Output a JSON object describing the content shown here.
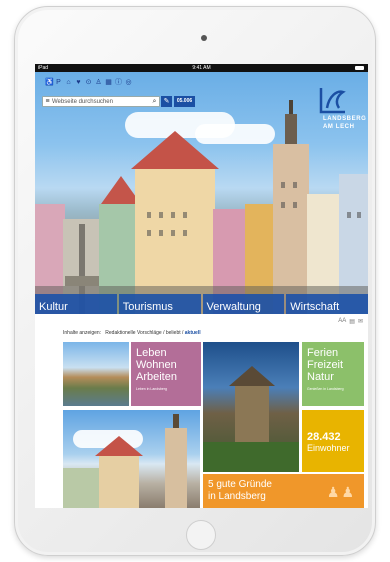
{
  "status_bar": {
    "carrier": "iPad",
    "time": "9:41 AM"
  },
  "header": {
    "search_placeholder": "Webseite durchsuchen",
    "dialog_button": "05.006"
  },
  "logo": {
    "line1": "LANDSBERG",
    "line2": "AM LECH"
  },
  "nav": {
    "items": [
      "Kultur",
      "Tourismus",
      "Verwaltung",
      "Wirtschaft"
    ]
  },
  "filter": {
    "label": "Inhalte anzeigen:",
    "options": [
      "Redaktionelle Vorschläge",
      "beliebt",
      "aktuell"
    ],
    "separator": "/"
  },
  "tools": {
    "text_size": "AA"
  },
  "tiles": {
    "leben": {
      "title": [
        "Leben",
        "Wohnen",
        "Arbeiten"
      ],
      "sub": "Leben in Landsberg"
    },
    "ferien": {
      "title": [
        "Ferien",
        "Freizeit",
        "Natur"
      ],
      "sub": "Genießen in Landsberg"
    },
    "stat": {
      "number": "28.432",
      "label": "Einwohner"
    },
    "gruende": {
      "title": [
        "5 gute Gründe",
        "in Landsberg"
      ]
    }
  },
  "colors": {
    "brand_blue": "#1b4fa3",
    "tile_purple": "#b36e98",
    "tile_green": "#8cc06a",
    "tile_yellow": "#e8b400",
    "tile_orange": "#f0972a"
  }
}
